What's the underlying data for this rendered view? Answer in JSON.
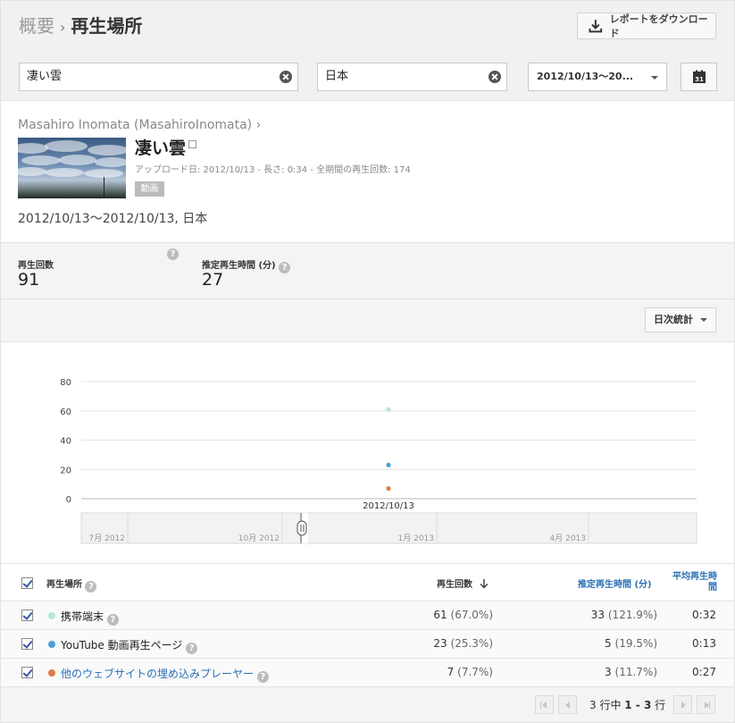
{
  "header": {
    "breadcrumb_root": "概要",
    "breadcrumb_sep": "›",
    "page_title": "再生場所",
    "download_label": "レポートをダウンロード"
  },
  "filters": {
    "content_value": "凄い雲",
    "region_value": "日本",
    "date_range_label": "2012/10/13〜20...",
    "calendar_day": "31"
  },
  "video": {
    "channel": "Masahiro Inomata (MasahiroInomata) ›",
    "title": "凄い雲",
    "meta": "アップロード日: 2012/10/13  -  長さ: 0:34  -  全期間の再生回数: 174",
    "tag": "動画",
    "range_text": "2012/10/13〜2012/10/13, 日本"
  },
  "metrics": {
    "views_label": "再生回数",
    "views_value": "91",
    "watch_label": "推定再生時間 (分)",
    "watch_value": "27",
    "help_glyph": "?"
  },
  "controls": {
    "granularity_label": "日次統計"
  },
  "chart_data": {
    "type": "scatter",
    "x": [
      "2012/10/13"
    ],
    "series": [
      {
        "name": "携帯端末",
        "values": [
          61
        ],
        "color": "#b5e6e0"
      },
      {
        "name": "YouTube 動画再生ページ",
        "values": [
          23
        ],
        "color": "#4a9ed4"
      },
      {
        "name": "他のウェブサイトの埋め込みプレーヤー",
        "values": [
          7
        ],
        "color": "#e07c45"
      }
    ],
    "yticks": [
      "80",
      "60",
      "40",
      "20",
      "0"
    ],
    "ylim": [
      0,
      80
    ],
    "x_label": "2012/10/13",
    "timeline_labels": [
      "7月 2012",
      "10月 2012",
      "1月 2013",
      "4月 2013"
    ],
    "grid": true
  },
  "table": {
    "col_location": "再生場所",
    "col_views": "再生回数",
    "col_watch": "推定再生時間 (分)",
    "col_avg": "平均再生時間",
    "rows": [
      {
        "name": "携帯端末",
        "views": "61",
        "views_pct": "(67.0%)",
        "watch": "33",
        "watch_pct": "(121.9%)",
        "avg": "0:32",
        "color": "#b5e6e0",
        "name_color": "#222"
      },
      {
        "name": "YouTube 動画再生ページ",
        "views": "23",
        "views_pct": "(25.3%)",
        "watch": "5",
        "watch_pct": "(19.5%)",
        "avg": "0:13",
        "color": "#4a9ed4",
        "name_color": "#222"
      },
      {
        "name": "他のウェブサイトの埋め込みプレーヤー",
        "views": "7",
        "views_pct": "(7.7%)",
        "watch": "3",
        "watch_pct": "(11.7%)",
        "avg": "0:27",
        "color": "#e07c45",
        "name_color": "#2a6fb5"
      }
    ]
  },
  "pagination": {
    "prefix": "3 行中 ",
    "range": "1 - 3",
    "suffix": " 行"
  }
}
